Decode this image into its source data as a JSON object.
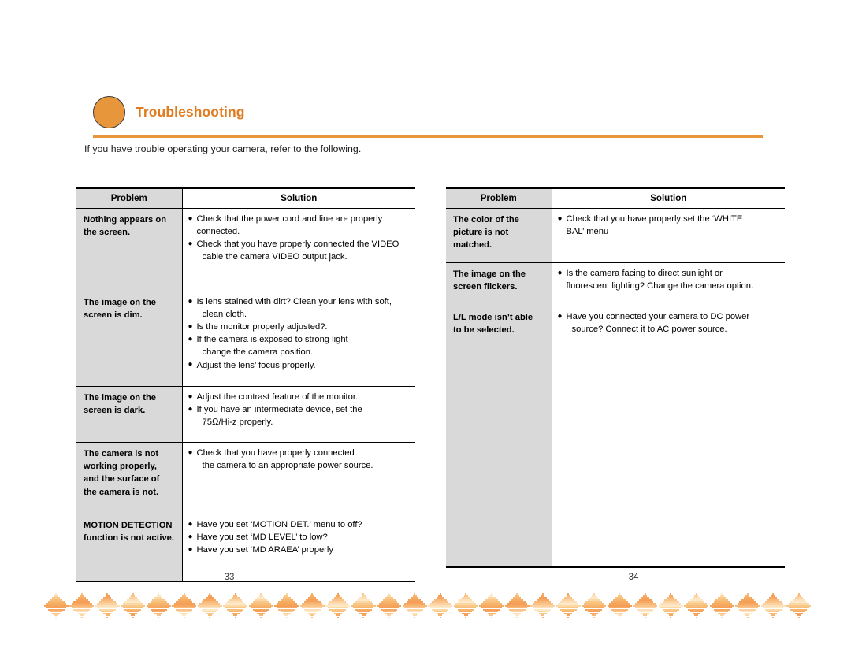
{
  "heading": {
    "title": "Troubleshooting",
    "circle_color": "#e8963c",
    "title_color": "#e07b20",
    "rule_color": "#e8963c"
  },
  "intro": "If you have trouble operating your camera, refer to the following.",
  "tables": {
    "left": {
      "headers": [
        "Problem",
        "Solution"
      ],
      "rows": [
        {
          "problem": [
            "Nothing appears on",
            "the screen."
          ],
          "solution": [
            {
              "bullet": true,
              "text": "Check that the power cord and line are properly"
            },
            {
              "bullet": false,
              "text": "connected.",
              "indent": false
            },
            {
              "bullet": true,
              "text": "Check that you have properly connected the VIDEO"
            },
            {
              "bullet": false,
              "text": "cable the camera VIDEO output jack.",
              "indent": true
            }
          ],
          "min_height": 92
        },
        {
          "problem": [
            "The image on the",
            "screen is dim."
          ],
          "solution": [
            {
              "bullet": true,
              "text": "Is lens stained with dirt? Clean your lens with soft,"
            },
            {
              "bullet": false,
              "text": "clean cloth.",
              "indent": true
            },
            {
              "bullet": true,
              "text": "Is the monitor properly adjusted?."
            },
            {
              "bullet": true,
              "text": "If the camera is exposed to strong light"
            },
            {
              "bullet": false,
              "text": "change the camera position.",
              "indent": true
            },
            {
              "bullet": true,
              "text": "Adjust the lens’ focus properly."
            }
          ],
          "min_height": 108
        },
        {
          "problem": [
            "The image on the",
            "screen is dark."
          ],
          "solution": [
            {
              "bullet": true,
              "text": "Adjust the contrast feature of the monitor."
            },
            {
              "bullet": true,
              "text": "If you have an intermediate device, set the"
            },
            {
              "bullet": false,
              "text": "75Ω/Hi-z properly.",
              "indent": true
            }
          ],
          "min_height": 58
        },
        {
          "problem": [
            "The camera is not",
            "working properly,",
            "and  the surface of",
            "the camera is not."
          ],
          "solution": [
            {
              "bullet": true,
              "text": "Check that you have properly connected"
            },
            {
              "bullet": false,
              "text": "the camera to an appropriate power source.",
              "indent": true
            }
          ],
          "min_height": 78
        },
        {
          "problem": [
            "MOTION DETECTION",
            "function is not active."
          ],
          "solution": [
            {
              "bullet": true,
              "text": "Have you set ‘MOTION DET.’ menu to off?"
            },
            {
              "bullet": true,
              "text": "Have you set ‘MD LEVEL’ to low?"
            },
            {
              "bullet": true,
              "text": "Have you set ‘MD ARAEA’ properly"
            }
          ],
          "min_height": 72
        }
      ]
    },
    "right": {
      "headers": [
        "Problem",
        "Solution"
      ],
      "rows": [
        {
          "problem": [
            "The color of the",
            "picture is not",
            "matched."
          ],
          "solution": [
            {
              "bullet": true,
              "text": "Check that you have properly set the ‘WHITE"
            },
            {
              "bullet": false,
              "text": "BAL’  menu",
              "indent": false
            }
          ],
          "min_height": 56
        },
        {
          "problem": [
            "The image on the",
            "screen flickers."
          ],
          "solution": [
            {
              "bullet": true,
              "text": "Is the camera facing to direct sunlight or"
            },
            {
              "bullet": false,
              "text": "fluorescent lighting? Change the camera option.",
              "indent": false
            }
          ],
          "min_height": 42
        },
        {
          "problem": [
            "L/L mode isn’t able",
            "to be selected."
          ],
          "solution": [
            {
              "bullet": true,
              "text": "Have you connected your camera to DC power"
            },
            {
              "bullet": false,
              "text": "source? Connect it to AC power source.",
              "indent": true
            }
          ],
          "min_height": 318
        }
      ]
    }
  },
  "page_numbers": {
    "left": "33",
    "right": "34"
  },
  "footer_ornament": {
    "diamond_count": 30,
    "stripe_colors": [
      "#fde8c8",
      "#fbd9a4",
      "#f9c888",
      "#f8bf7a",
      "#f7b46c",
      "#f6ab63",
      "#f5a45c",
      "#f49e58",
      "#f6a862",
      "#f8b878",
      "#fac38a",
      "#fbd2a0",
      "#fce0bb"
    ]
  }
}
